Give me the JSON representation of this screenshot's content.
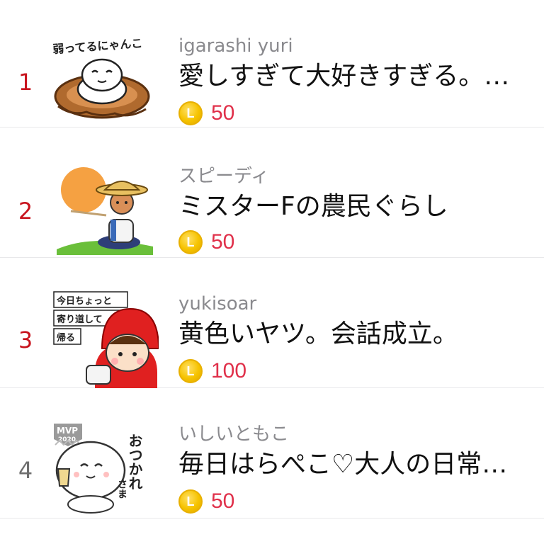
{
  "rankings": [
    {
      "rank": "1",
      "author": "igarashi yuri",
      "title": "愛しすぎて大好きすぎる。…",
      "price": "50",
      "sticker_text": "弱ってるにゃんこ"
    },
    {
      "rank": "2",
      "author": "スピーディ",
      "title": "ミスターFの農民ぐらし",
      "price": "50"
    },
    {
      "rank": "3",
      "author": "yukisoar",
      "title": "黄色いヤツ。会話成立。",
      "price": "100",
      "sticker_text": [
        "今日ちょっと",
        "寄り道して",
        "帰る"
      ]
    },
    {
      "rank": "4",
      "author": "いしいともこ",
      "title": "毎日はらぺこ♡大人の日常…",
      "price": "50",
      "badge": [
        "MVP",
        "2020"
      ],
      "sticker_text": [
        "おつかれ",
        "さま"
      ]
    }
  ],
  "coin_symbol": "L",
  "colors": {
    "rank_top": "#c8141e",
    "rank_other": "#6e6e6e",
    "price": "#e0304a",
    "coin": "#f6c300"
  }
}
